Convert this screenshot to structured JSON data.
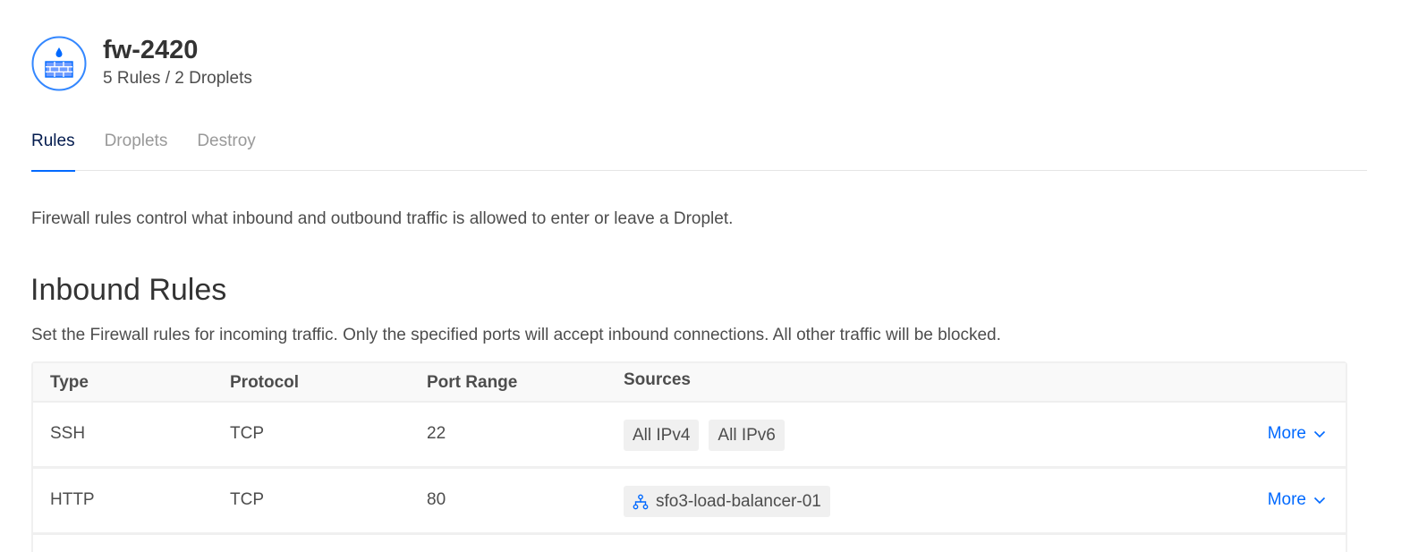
{
  "header": {
    "title": "fw-2420",
    "subtitle": "5 Rules / 2 Droplets"
  },
  "tabs": [
    {
      "label": "Rules",
      "active": true
    },
    {
      "label": "Droplets",
      "active": false
    },
    {
      "label": "Destroy",
      "active": false
    }
  ],
  "intro": "Firewall rules control what inbound and outbound traffic is allowed to enter or leave a Droplet.",
  "inbound": {
    "title": "Inbound Rules",
    "description": "Set the Firewall rules for incoming traffic. Only the specified ports will accept inbound connections. All other traffic will be blocked.",
    "columns": {
      "type": "Type",
      "protocol": "Protocol",
      "port_range": "Port Range",
      "sources": "Sources"
    },
    "rows": [
      {
        "type": "SSH",
        "protocol": "TCP",
        "port": "22",
        "sources": [
          "All IPv4",
          "All IPv6"
        ],
        "more": "More"
      },
      {
        "type": "HTTP",
        "protocol": "TCP",
        "port": "80",
        "sources": [
          "sfo3-load-balancer-01"
        ],
        "more": "More"
      }
    ]
  },
  "icons": {
    "firewall": "firewall-icon",
    "load_balancer": "load-balancer-icon",
    "chevron": "chevron-down-icon"
  },
  "colors": {
    "accent": "#0069ff",
    "active_tab": "#031b4e"
  }
}
